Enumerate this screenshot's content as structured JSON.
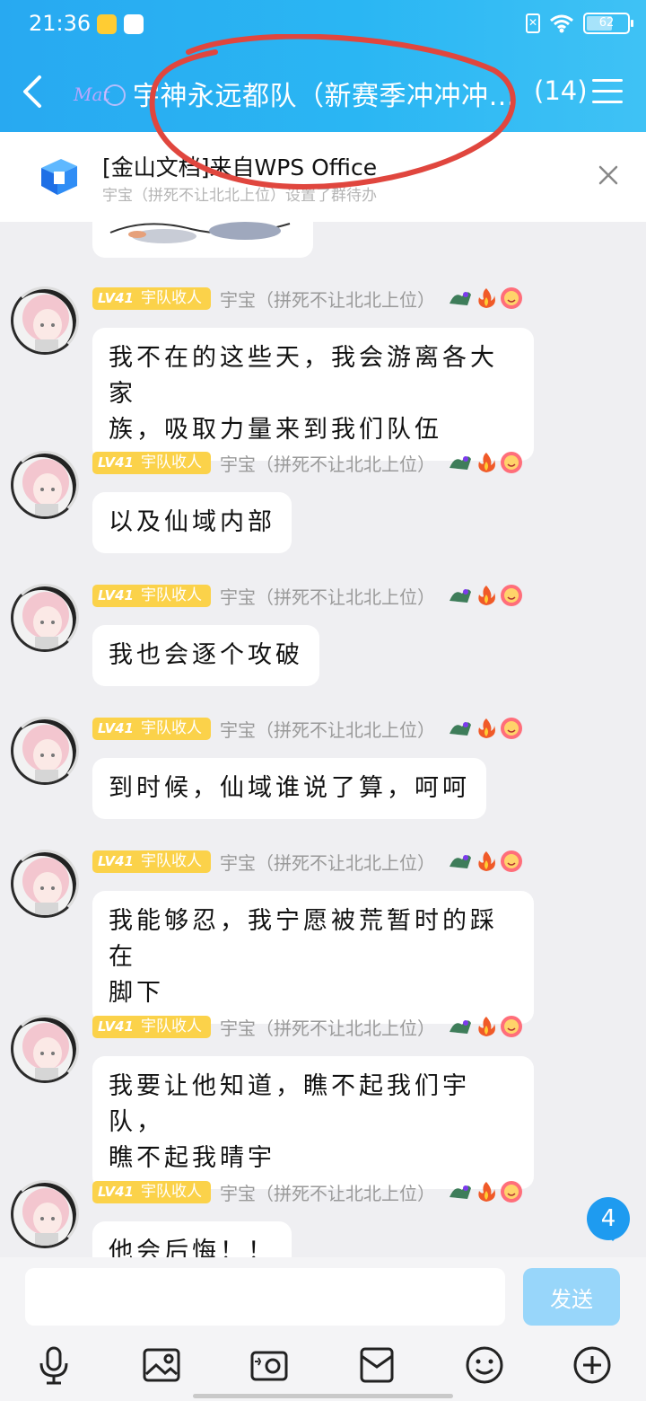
{
  "status_bar": {
    "time": "21:36",
    "battery": "62"
  },
  "header": {
    "title": "宇神永远都队（新赛季冲冲冲…",
    "member_count": "(14)"
  },
  "notice": {
    "title": "[金山文档]来自WPS Office",
    "subtitle": "宇宝（拼死不让北北上位）设置了群待办"
  },
  "messages": [
    {
      "level": "LV41",
      "rank": "宇队收人",
      "sender": "宇宝（拼死不让北北上位）",
      "lines": [
        "我不在的这些天，我会游离各大家",
        "族，吸取力量来到我们队伍"
      ]
    },
    {
      "level": "LV41",
      "rank": "宇队收人",
      "sender": "宇宝（拼死不让北北上位）",
      "lines": [
        "以及仙域内部"
      ]
    },
    {
      "level": "LV41",
      "rank": "宇队收人",
      "sender": "宇宝（拼死不让北北上位）",
      "lines": [
        "我也会逐个攻破"
      ]
    },
    {
      "level": "LV41",
      "rank": "宇队收人",
      "sender": "宇宝（拼死不让北北上位）",
      "lines": [
        "到时候，仙域谁说了算，呵呵"
      ]
    },
    {
      "level": "LV41",
      "rank": "宇队收人",
      "sender": "宇宝（拼死不让北北上位）",
      "lines": [
        "我能够忍，我宁愿被荒暂时的踩在",
        "脚下"
      ]
    },
    {
      "level": "LV41",
      "rank": "宇队收人",
      "sender": "宇宝（拼死不让北北上位）",
      "lines": [
        "我要让他知道，瞧不起我们宇队，",
        "瞧不起我晴宇"
      ]
    },
    {
      "level": "LV41",
      "rank": "宇队收人",
      "sender": "宇宝（拼死不让北北上位）",
      "lines": [
        "他会后悔！！"
      ]
    }
  ],
  "unread_count": "4",
  "input_bar": {
    "placeholder": "",
    "send_label": "发送"
  },
  "toolbar_icons": [
    "microphone-icon",
    "image-icon",
    "camera-icon",
    "red-packet-icon",
    "emoji-icon",
    "plus-icon"
  ],
  "colors": {
    "header": "#2ab6f3",
    "level_badge": "#fbd24a",
    "send_button": "#98d6fa",
    "unread_badge": "#1e9bf0"
  }
}
